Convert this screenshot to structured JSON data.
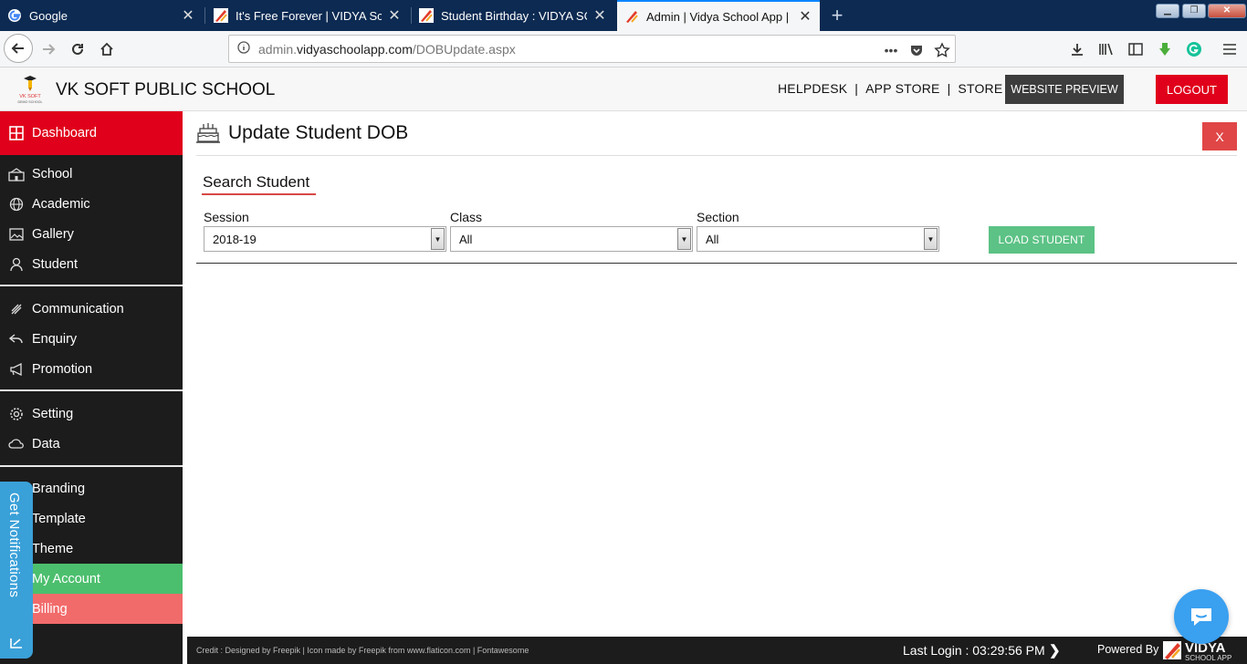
{
  "browser": {
    "tabs": [
      {
        "title": "Google",
        "icon": "google-icon",
        "active": false
      },
      {
        "title": "It's Free Forever | VIDYA School",
        "icon": "vidya-icon",
        "active": false
      },
      {
        "title": "Student Birthday : VIDYA SCHOO",
        "icon": "vidya-icon",
        "active": false
      },
      {
        "title": "Admin | Vidya School App | It's",
        "icon": "vidya-icon",
        "active": true
      }
    ],
    "new_tab": "+",
    "url_prefix": "admin.",
    "url_domain": "vidyaschoolapp.com",
    "url_path": "/DOBUpdate.aspx",
    "overflow": "•••"
  },
  "header": {
    "school_name": "VK SOFT PUBLIC SCHOOL",
    "logo_text": "VK SOFT",
    "logo_subtext": "DEMO SCHOOL",
    "links": [
      "HELPDESK",
      "APP STORE",
      "STORE"
    ],
    "website_preview": "WEBSITE PREVIEW",
    "logout": "LOGOUT"
  },
  "sidebar": {
    "items": [
      {
        "label": "Dashboard",
        "icon": "dashboard-icon"
      },
      {
        "label": "School",
        "icon": "school-icon"
      },
      {
        "label": "Academic",
        "icon": "globe-icon"
      },
      {
        "label": "Gallery",
        "icon": "image-icon"
      },
      {
        "label": "Student",
        "icon": "student-icon"
      },
      {
        "label": "Communication",
        "icon": "broadcast-icon"
      },
      {
        "label": "Enquiry",
        "icon": "reply-icon"
      },
      {
        "label": "Promotion",
        "icon": "megaphone-icon"
      },
      {
        "label": "Setting",
        "icon": "gear-icon"
      },
      {
        "label": "Data",
        "icon": "cloud-icon"
      },
      {
        "label": "Branding",
        "icon": "brush-icon"
      },
      {
        "label": "Template",
        "icon": "template-icon"
      },
      {
        "label": "Theme",
        "icon": "theme-icon"
      },
      {
        "label": "My Account",
        "icon": "user-icon"
      },
      {
        "label": "Billing",
        "icon": "billing-icon"
      }
    ],
    "notifications_tab": "Get Notifications"
  },
  "main": {
    "title": "Update Student DOB",
    "close_label": "X",
    "section_heading": "Search Student",
    "fields": [
      {
        "label": "Session",
        "value": "2018-19"
      },
      {
        "label": "Class",
        "value": "All"
      },
      {
        "label": "Section",
        "value": "All"
      }
    ],
    "load_button": "LOAD STUDENT"
  },
  "footer": {
    "credit": "Credit : Designed by Freepik | Icon made by Freepik from www.flaticon.com | Fontawesome",
    "last_login": "Last Login : 03:29:56 PM",
    "powered_by": "Powered By",
    "brand": "VIDYA",
    "brand_sub": "SCHOOL APP"
  },
  "colors": {
    "accent_red": "#e0001b",
    "sidebar_bg": "#1c1c1c",
    "success_green": "#5cc285",
    "my_account_green": "#4cbf6e",
    "billing_red": "#f26b6b",
    "notification_blue": "#3aa0d8"
  }
}
